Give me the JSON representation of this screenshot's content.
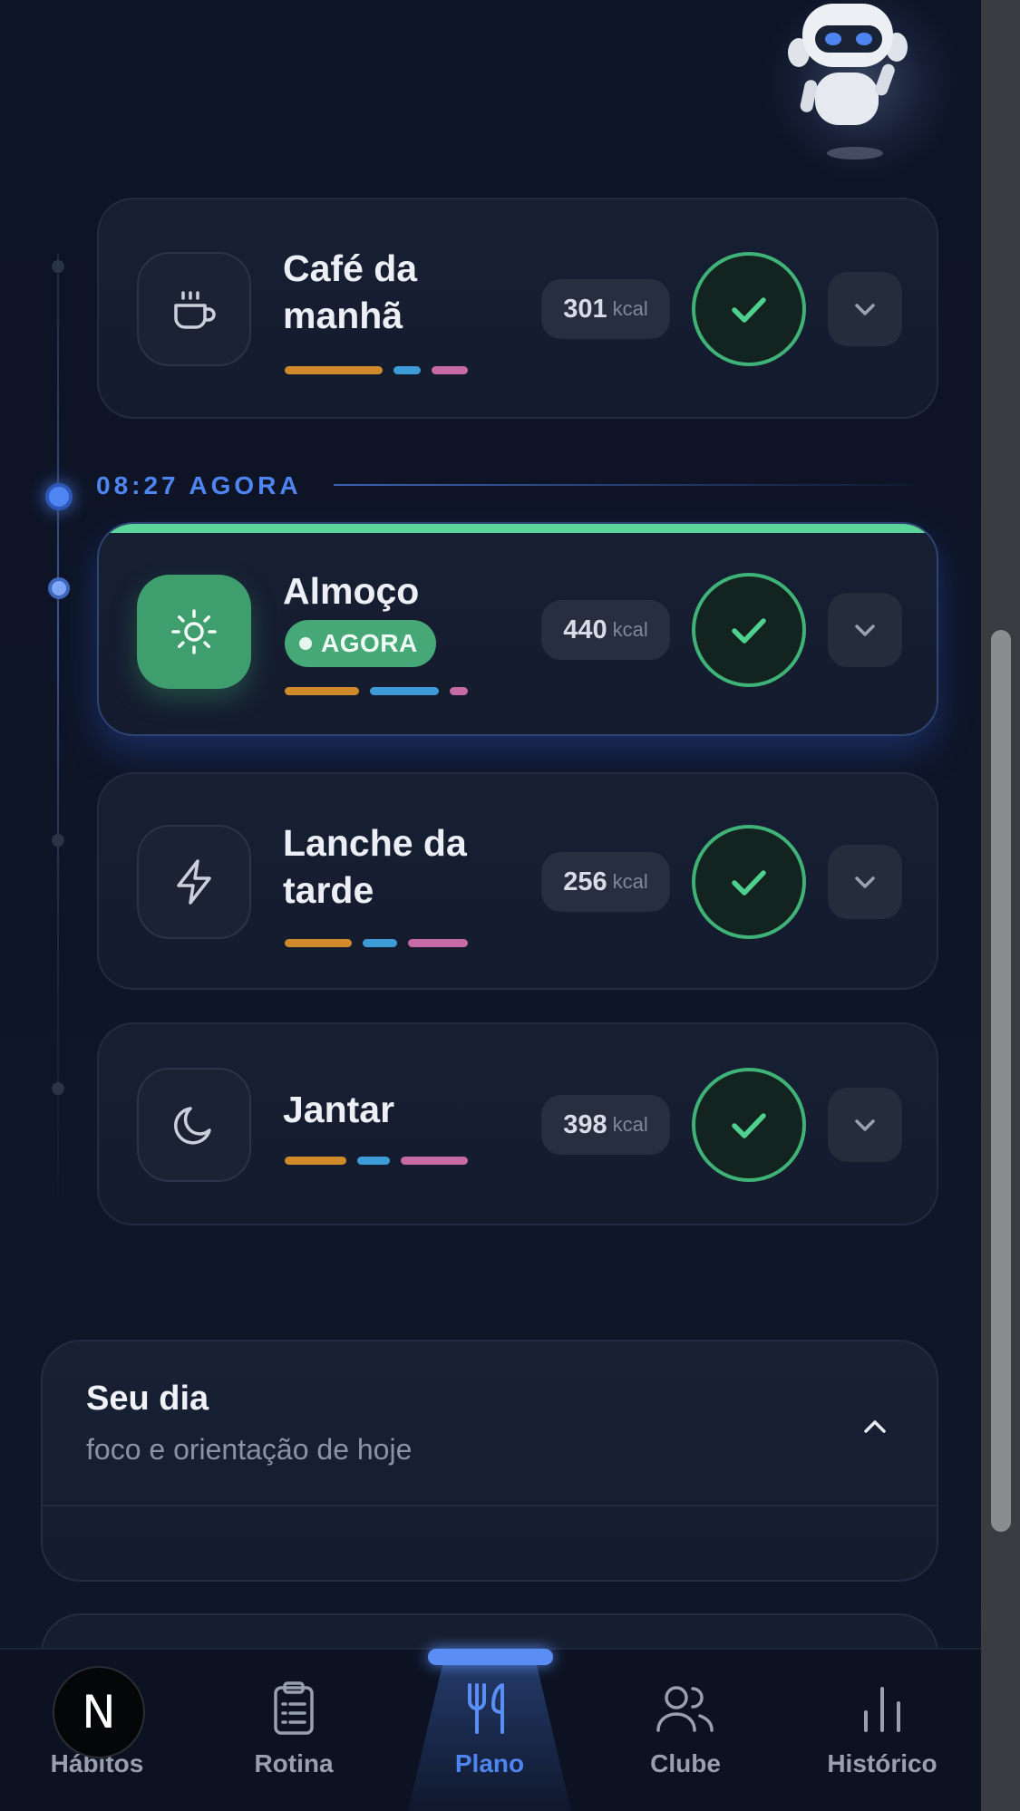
{
  "now_marker": {
    "label": "08:27 AGORA"
  },
  "meals": [
    {
      "title_line1": "Café da",
      "title_line2": "manhã",
      "kcal": "301",
      "unit": "kcal",
      "icon": "coffee-cup-icon"
    },
    {
      "title_line1": "Almoço",
      "badge": "AGORA",
      "kcal": "440",
      "unit": "kcal",
      "icon": "sun-icon"
    },
    {
      "title_line1": "Lanche da",
      "title_line2": "tarde",
      "kcal": "256",
      "unit": "kcal",
      "icon": "lightning-icon"
    },
    {
      "title_line1": "Jantar",
      "kcal": "398",
      "unit": "kcal",
      "icon": "moon-icon"
    }
  ],
  "seu_dia": {
    "title": "Seu dia",
    "subtitle": "foco e orientação de hoje"
  },
  "nav": {
    "items": [
      {
        "label": "Hábitos",
        "icon": "habits-icon"
      },
      {
        "label": "Rotina",
        "icon": "clipboard-icon"
      },
      {
        "label": "Plano",
        "icon": "fork-knife-icon",
        "active": true
      },
      {
        "label": "Clube",
        "icon": "users-icon"
      },
      {
        "label": "Histórico",
        "icon": "bar-chart-icon"
      }
    ],
    "badge_letter": "N"
  },
  "colors": {
    "accent_blue": "#4f85f0",
    "accent_green": "#3fb377",
    "macro_orange": "#d08a2a",
    "macro_blue": "#3d9bd8",
    "macro_pink": "#c66aa5"
  }
}
